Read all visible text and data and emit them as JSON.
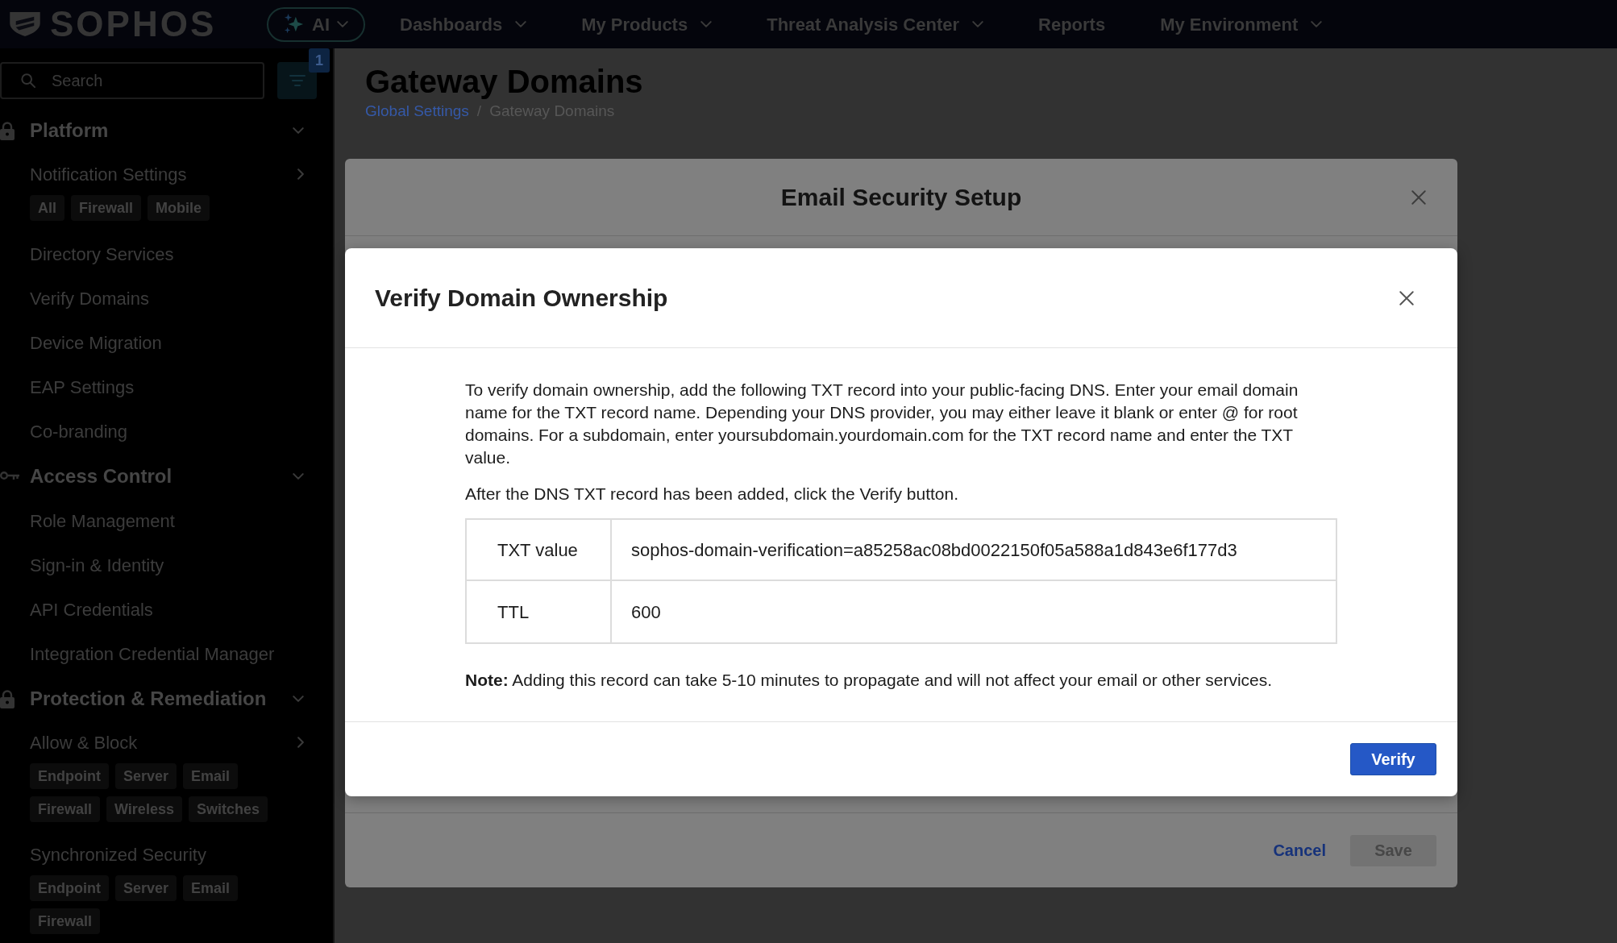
{
  "top_bar": {
    "logo": "SOPHOS",
    "ai_menu": {
      "label": "AI"
    },
    "menu": [
      {
        "label": "Dashboards",
        "has_dropdown": true
      },
      {
        "label": "My Products",
        "has_dropdown": true
      },
      {
        "label": "Threat Analysis Center",
        "has_dropdown": true
      },
      {
        "label": "Reports",
        "has_dropdown": false
      },
      {
        "label": "My Environment",
        "has_dropdown": true
      }
    ]
  },
  "sidebar": {
    "search": {
      "placeholder": "Search"
    },
    "filter_badge": "1",
    "sections": [
      {
        "title": "Platform",
        "expanded": true,
        "items": [
          {
            "label": "Notification Settings",
            "has_submenu": true,
            "tags": [
              "All",
              "Firewall",
              "Mobile"
            ]
          },
          {
            "label": "Directory Services",
            "has_submenu": false
          },
          {
            "label": "Verify Domains",
            "has_submenu": false
          },
          {
            "label": "Device Migration",
            "has_submenu": false
          },
          {
            "label": "EAP Settings",
            "has_submenu": false
          },
          {
            "label": "Co-branding",
            "has_submenu": false
          }
        ]
      },
      {
        "title": "Access Control",
        "expanded": true,
        "items": [
          {
            "label": "Role Management",
            "has_submenu": false
          },
          {
            "label": "Sign-in & Identity",
            "has_submenu": false
          },
          {
            "label": "API Credentials",
            "has_submenu": false
          },
          {
            "label": "Integration Credential Manager",
            "has_submenu": false
          }
        ]
      },
      {
        "title": "Protection & Remediation",
        "expanded": true,
        "items": [
          {
            "label": "Allow & Block",
            "has_submenu": true,
            "tags": [
              "Endpoint",
              "Server",
              "Email",
              "Firewall",
              "Wireless",
              "Switches"
            ]
          },
          {
            "label": "Synchronized Security",
            "has_submenu": false,
            "tags": [
              "Endpoint",
              "Server",
              "Email",
              "Firewall"
            ]
          }
        ]
      }
    ]
  },
  "page": {
    "title": "Gateway Domains",
    "breadcrumbs": [
      {
        "label": "Global Settings",
        "current": false
      },
      {
        "label": "Gateway Domains",
        "current": true
      }
    ],
    "breadcrumb_separator": "/"
  },
  "setup_dialog": {
    "title": "Email Security Setup",
    "buttons": [
      {
        "label": "Cancel",
        "kind": "link",
        "disabled": false
      },
      {
        "label": "Save",
        "kind": "primary",
        "disabled": true
      }
    ]
  },
  "verify_dialog": {
    "title": "Verify Domain Ownership",
    "paragraphs": [
      "To verify domain ownership, add the following TXT record into your public-facing DNS. Enter your email domain name for the TXT record name. Depending your DNS provider, you may either leave it blank or enter @ for root domains. For a subdomain, enter yoursubdomain.yourdomain.com for the TXT record name and enter the TXT value.",
      "After the DNS TXT record has been added, click the Verify button."
    ],
    "record": [
      {
        "label": "TXT value",
        "value": "sophos-domain-verification=a85258ac08bd0022150f05a588a1d843e6f177d3"
      },
      {
        "label": "TTL",
        "value": "600"
      }
    ],
    "note": "**Note:** Adding this record can take 5-10 minutes to propagate and will not affect your email or other services.",
    "button": "Verify"
  }
}
